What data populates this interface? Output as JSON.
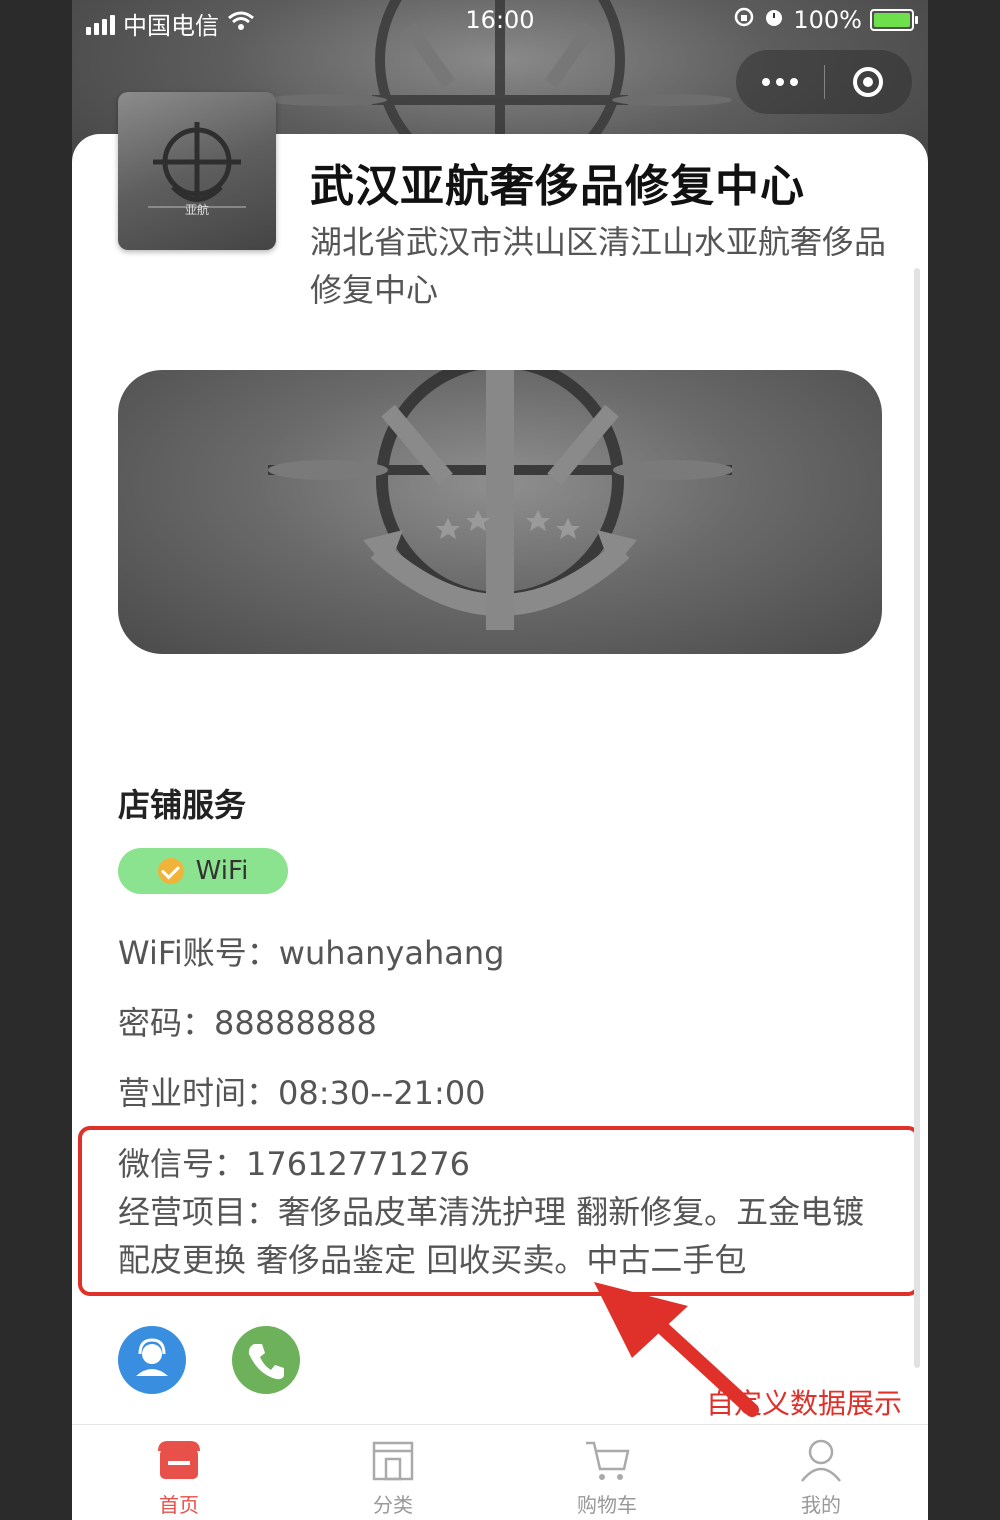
{
  "status_bar": {
    "carrier": "中国电信",
    "time": "16:00",
    "battery": "100%"
  },
  "shop": {
    "name": "武汉亚航奢侈品修复中心",
    "address": "湖北省武汉市洪山区清江山水亚航奢侈品修复中心",
    "logo_text": "亚航"
  },
  "services": {
    "title": "店铺服务",
    "tags": [
      "WiFi"
    ],
    "wifi_account": "WiFi账号：wuhanyahang",
    "password": "密码：88888888",
    "business_hours": "营业时间：08:30--21:00"
  },
  "custom_data": {
    "wechat": "微信号：17612771276",
    "business_scope": "经营项目：奢侈品皮革清洗护理 翻新修复。五金电镀 配皮更换 奢侈品鉴定 回收买卖。中古二手包"
  },
  "annotation": {
    "label": "自定义数据展示",
    "color": "#e0302a"
  },
  "tabbar": {
    "items": [
      {
        "label": "首页",
        "icon": "home-shop-icon",
        "active": true
      },
      {
        "label": "分类",
        "icon": "store-icon",
        "active": false
      },
      {
        "label": "购物车",
        "icon": "cart-icon",
        "active": false
      },
      {
        "label": "我的",
        "icon": "user-icon",
        "active": false
      }
    ],
    "active_color": "#e8504a",
    "inactive_color": "#999999"
  }
}
